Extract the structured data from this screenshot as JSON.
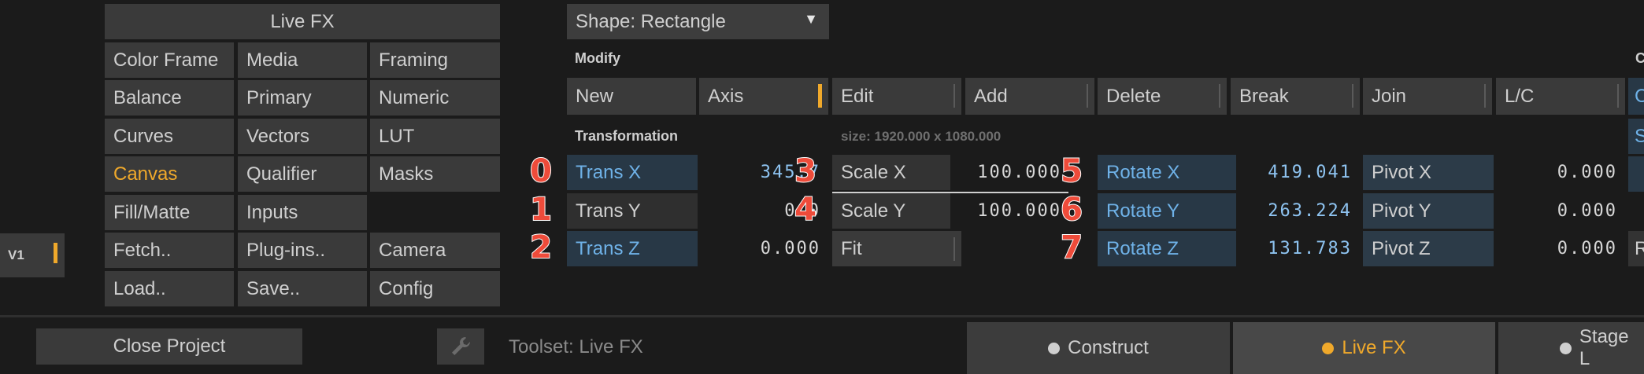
{
  "left_panel": {
    "title": "Live FX",
    "buttons": [
      [
        "Color Frame",
        "Media",
        "Framing"
      ],
      [
        "Balance",
        "Primary",
        "Numeric"
      ],
      [
        "Curves",
        "Vectors",
        "LUT"
      ],
      [
        "Canvas",
        "Qualifier",
        "Masks"
      ],
      [
        "Fill/Matte",
        "Inputs",
        ""
      ],
      [
        "Fetch..",
        "Plug-ins..",
        "Camera"
      ],
      [
        "Load..",
        "Save..",
        "Config"
      ]
    ],
    "active": "Canvas",
    "version_label": "V1"
  },
  "shape": {
    "label": "Shape: Rectangle",
    "arrow": "▼"
  },
  "modify": {
    "heading": "Modify",
    "buttons": [
      "New",
      "Axis",
      "Edit",
      "Add",
      "Delete",
      "Break",
      "Join",
      "L/C"
    ]
  },
  "transformation": {
    "heading": "Transformation",
    "size": "size: 1920.000 x 1080.000",
    "trans": [
      {
        "label": "Trans X",
        "value": "345.7"
      },
      {
        "label": "Trans Y",
        "value": "0.0"
      },
      {
        "label": "Trans Z",
        "value": "0.000"
      }
    ],
    "scale": [
      {
        "label": "Scale X",
        "value": "100.000"
      },
      {
        "label": "Scale Y",
        "value": "100.000"
      },
      {
        "label": "Fit",
        "value": ""
      }
    ],
    "rotate": [
      {
        "label": "Rotate X",
        "value": "419.041"
      },
      {
        "label": "Rotate Y",
        "value": "263.224"
      },
      {
        "label": "Rotate Z",
        "value": "131.783"
      }
    ],
    "pivot": [
      {
        "label": "Pivot X",
        "value": "0.000"
      },
      {
        "label": "Pivot Y",
        "value": "0.000"
      },
      {
        "label": "Pivot Z",
        "value": "0.000"
      }
    ]
  },
  "badges": [
    "0",
    "1",
    "2",
    "3",
    "4",
    "5",
    "6",
    "7"
  ],
  "right_edge": {
    "header": "C",
    "row1": "C",
    "row2": "S",
    "row3": "R"
  },
  "bottom": {
    "close_project": "Close Project",
    "toolset": "Toolset: Live FX",
    "tabs": [
      {
        "label": "Construct",
        "dot": "#cfcfcf"
      },
      {
        "label": "Live FX",
        "dot": "#f0a92b",
        "active": true
      },
      {
        "label": "Stage L",
        "dot": "#cfcfcf"
      }
    ]
  },
  "colors": {
    "accent": "#f0a92b",
    "value_blue": "#8ec3f0",
    "badge_red": "#ee4b3a"
  }
}
